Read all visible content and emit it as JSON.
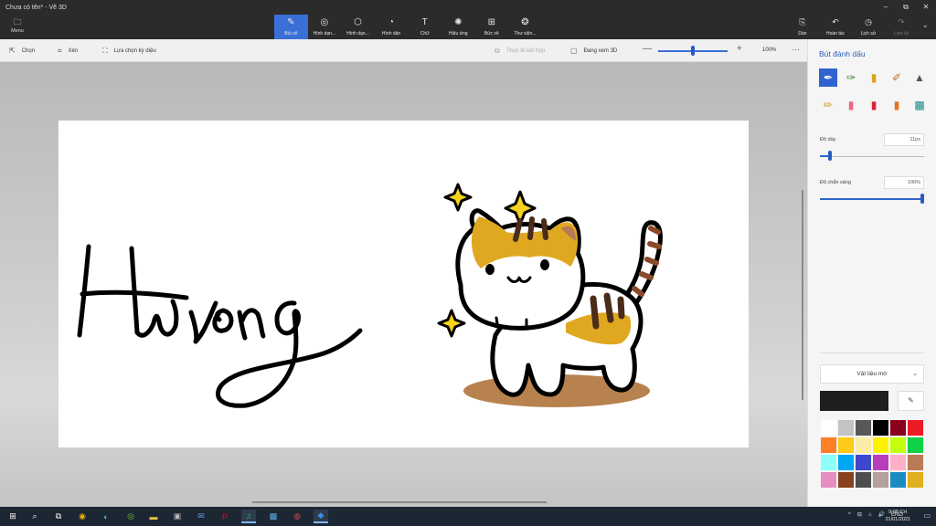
{
  "window": {
    "title": "Chưa có tên* - Vẽ 3D",
    "controls": {
      "minimize": "–",
      "maximize": "⧉",
      "close": "✕"
    }
  },
  "menu": {
    "icon": "folder-icon",
    "glyph": "🗀",
    "label": "Menu"
  },
  "tools": [
    {
      "name": "brushes",
      "icon": "brush-icon",
      "glyph": "✎",
      "label": "Bút vẽ",
      "active": true
    },
    {
      "name": "2d-shapes",
      "icon": "shapes-2d-icon",
      "glyph": "◎",
      "label": "Hình dạn..."
    },
    {
      "name": "3d-shapes",
      "icon": "cube-icon",
      "glyph": "⬡",
      "label": "Hình dạn..."
    },
    {
      "name": "stickers",
      "icon": "sticker-icon",
      "glyph": "◔",
      "label": "Hình dán"
    },
    {
      "name": "text",
      "icon": "text-icon",
      "glyph": "T",
      "label": "Chữ"
    },
    {
      "name": "effects",
      "icon": "effects-icon",
      "glyph": "✺",
      "label": "Hiệu ứng"
    },
    {
      "name": "canvas",
      "icon": "canvas-icon",
      "glyph": "⊞",
      "label": "Bức vẽ"
    },
    {
      "name": "library",
      "icon": "library-icon",
      "glyph": "❂",
      "label": "Thư viện..."
    }
  ],
  "right_tools": [
    {
      "name": "paste",
      "icon": "paste-icon",
      "glyph": "⎘",
      "label": "Dán",
      "disabled": false
    },
    {
      "name": "undo",
      "icon": "undo-icon",
      "glyph": "↶",
      "label": "Hoàn tác",
      "disabled": false
    },
    {
      "name": "history",
      "icon": "history-icon",
      "glyph": "◷",
      "label": "Lịch sử",
      "disabled": false
    },
    {
      "name": "redo",
      "icon": "redo-icon",
      "glyph": "↷",
      "label": "Làm lại",
      "disabled": true
    }
  ],
  "expand_glyph": "⌄",
  "subbar": {
    "select": {
      "glyph": "⇱",
      "label": "Chọn"
    },
    "crop": {
      "glyph": "⌗",
      "label": "Xén"
    },
    "magic_select": {
      "glyph": "⛶",
      "label": "Lựa chọn kỳ diệu"
    },
    "mixed_reality": {
      "glyph": "⧉",
      "label": "Thực tế kết hợp"
    },
    "view_3d": {
      "glyph": "▢",
      "label": "Đang xem 3D"
    },
    "zoom_minus": "—",
    "zoom_plus": "+",
    "zoom_value": "100%",
    "zoom_level": 0.5,
    "more": "···"
  },
  "panel": {
    "title": "Bút đánh dấu",
    "brushes_row1": [
      "✒",
      "✑",
      "▮",
      "✐",
      "▲"
    ],
    "brushes_row2": [
      "✏",
      "▮",
      "▮",
      "▮",
      "▩"
    ],
    "thickness_label": "Độ dày",
    "thickness_value": "11px",
    "thickness_level": 0.1,
    "opacity_label": "Độ chắn sáng",
    "opacity_value": "100%",
    "opacity_level": 1.0,
    "material": "Vật liệu mờ",
    "material_chevron": "⌄",
    "current_color": "#1f1f1f",
    "eyedropper_glyph": "✎",
    "swatches": [
      "#ffffff",
      "#c3c3c3",
      "#585858",
      "#000000",
      "#88001b",
      "#ec1c24",
      "#ff7f27",
      "#ffca18",
      "#fdeca6",
      "#fff200",
      "#c4ff0e",
      "#0ed145",
      "#8cfffb",
      "#00a8f3",
      "#3f48cc",
      "#b83dba",
      "#ffaec8",
      "#b97a56",
      "#e68ec2",
      "#88421e",
      "#4e4e4e",
      "#b4a09c",
      "#1b8cc2",
      "#e0b01e"
    ]
  },
  "taskbar": {
    "items": [
      {
        "name": "start",
        "glyph": "⊞",
        "icon": "windows-icon"
      },
      {
        "name": "search",
        "glyph": "⌕",
        "icon": "search-icon"
      },
      {
        "name": "task-view",
        "glyph": "⧉",
        "icon": "task-view-icon"
      },
      {
        "name": "chrome",
        "glyph": "◉",
        "icon": "chrome-icon"
      },
      {
        "name": "edge",
        "glyph": "◐",
        "icon": "edge-icon"
      },
      {
        "name": "app-green",
        "glyph": "◎",
        "icon": "app-icon"
      },
      {
        "name": "file-explorer",
        "glyph": "▬",
        "icon": "folder-icon"
      },
      {
        "name": "store",
        "glyph": "▣",
        "icon": "store-icon"
      },
      {
        "name": "mail",
        "glyph": "✉",
        "icon": "mail-icon"
      },
      {
        "name": "pinterest",
        "glyph": "P",
        "icon": "pinterest-icon"
      },
      {
        "name": "spotify",
        "glyph": "♫",
        "icon": "spotify-icon",
        "active": true
      },
      {
        "name": "photos",
        "glyph": "▩",
        "icon": "photos-icon"
      },
      {
        "name": "app-red",
        "glyph": "◍",
        "icon": "app-icon"
      },
      {
        "name": "paint3d",
        "glyph": "◆",
        "icon": "paint3d-icon",
        "active": true
      }
    ],
    "tray": [
      "^",
      "⊟",
      "⌂",
      "🔊",
      "ENG"
    ],
    "time": "9:08 CH",
    "date": "21/01/2021",
    "notif_glyph": "▭"
  }
}
